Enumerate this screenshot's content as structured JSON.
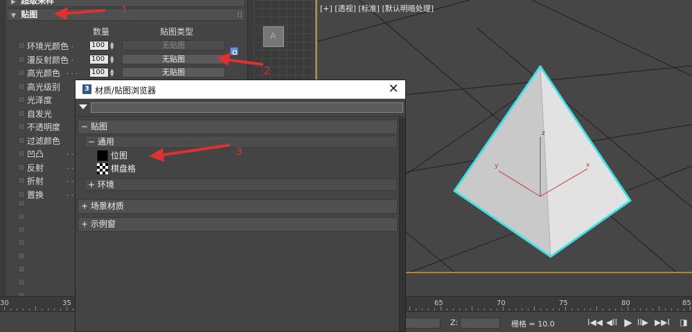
{
  "top_cut_rollout": "超级采样",
  "maps_rollout": {
    "title": "贴图",
    "header_amount": "数量",
    "header_map_type": "贴图类型"
  },
  "map_rows": [
    {
      "label": "环境光颜色",
      "dots": "..",
      "amount": "100",
      "map": "无贴图",
      "map_enabled": false
    },
    {
      "label": "漫反射颜色",
      "dots": "..",
      "amount": "100",
      "map": "无贴图",
      "map_enabled": true
    },
    {
      "label": "高光颜色",
      "dots": "...",
      "amount": "100",
      "map": "无贴图",
      "map_enabled": true
    },
    {
      "label": "高光级别"
    },
    {
      "label": "光泽度"
    },
    {
      "label": "自发光"
    },
    {
      "label": "不透明度"
    },
    {
      "label": "过滤颜色"
    },
    {
      "label": "凹凸",
      "dots": "...."
    },
    {
      "label": "反射",
      "dots": "...."
    },
    {
      "label": "折射",
      "dots": "...."
    },
    {
      "label": "置换",
      "dots": "...."
    }
  ],
  "viewport": {
    "label": "[+] [透视] [标准] [默认明暗处理]",
    "axis_x": "x",
    "axis_y": "y",
    "axis_z": "z"
  },
  "timeline": {
    "ticks": [
      "30",
      "35",
      "65",
      "70",
      "75",
      "80",
      "85"
    ]
  },
  "status": {
    "z_label": "Z:",
    "grid_label": "栅格 = 10.0"
  },
  "playback": {
    "prev_key": "I◀◀",
    "prev_frame": "◀II",
    "play": "▶",
    "next_frame": "II▶",
    "next_key": "▶▶I"
  },
  "dialog": {
    "app_icon": "3",
    "title": "材质/贴图浏览器",
    "close": "✕",
    "tree": {
      "maps_group": "− 贴图",
      "general_sub": "− 通用",
      "items": [
        "位图",
        "棋盘格"
      ],
      "env_sub": "+ 环境",
      "scene_materials": "+ 场景材质",
      "sample_slots": "+ 示例窗"
    }
  },
  "annotations": {
    "n1": "1",
    "n2": "2",
    "n3": "3"
  },
  "colors": {
    "selection_cyan": "#3ee0e8",
    "annotation_red": "#e03030",
    "viewport_border": "#b08a2a"
  }
}
